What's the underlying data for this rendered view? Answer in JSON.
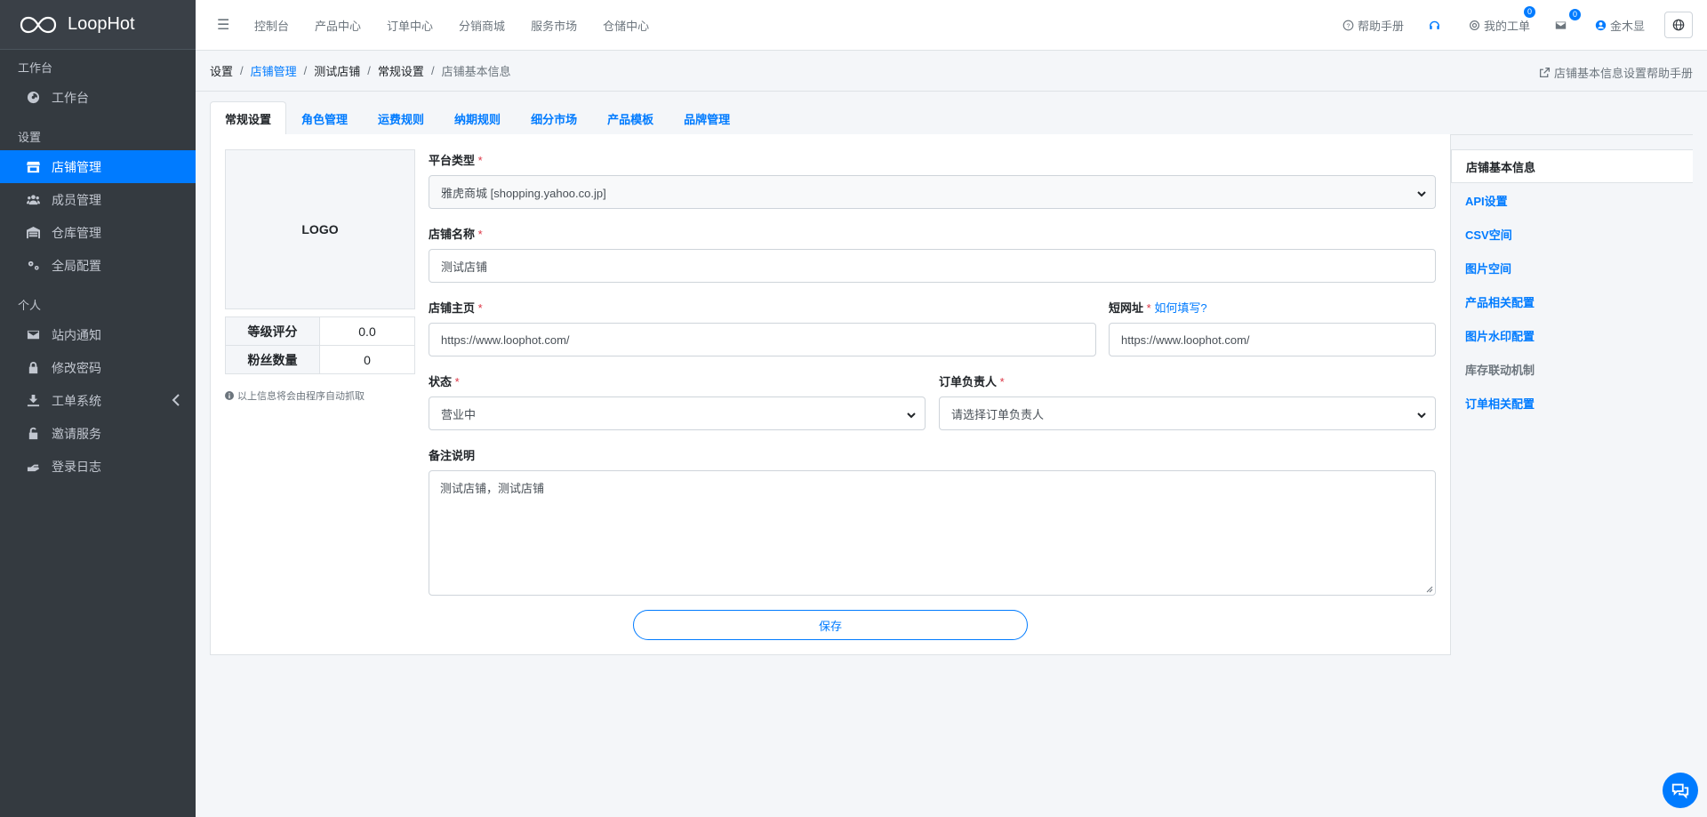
{
  "app": {
    "brand": "LoopHot"
  },
  "sidebar": {
    "sections": [
      {
        "header": "工作台",
        "items": [
          {
            "label": "工作台",
            "icon": "dashboard-icon"
          }
        ]
      },
      {
        "header": "设置",
        "items": [
          {
            "label": "店铺管理",
            "icon": "store-icon",
            "active": true
          },
          {
            "label": "成员管理",
            "icon": "users-icon"
          },
          {
            "label": "仓库管理",
            "icon": "warehouse-icon"
          },
          {
            "label": "全局配置",
            "icon": "cogs-icon"
          }
        ]
      },
      {
        "header": "个人",
        "items": [
          {
            "label": "站内通知",
            "icon": "envelope-icon"
          },
          {
            "label": "修改密码",
            "icon": "lock-icon"
          },
          {
            "label": "工单系统",
            "icon": "ticket-icon"
          },
          {
            "label": "邀请服务",
            "icon": "unlock-icon"
          },
          {
            "label": "登录日志",
            "icon": "hand-icon"
          }
        ]
      }
    ]
  },
  "topnav": {
    "items": [
      "控制台",
      "产品中心",
      "订单中心",
      "分销商城",
      "服务市场",
      "仓储中心"
    ]
  },
  "topright": {
    "help": "帮助手册",
    "tickets": "我的工单",
    "tickets_badge": "0",
    "mail_badge": "0",
    "user": "金木显"
  },
  "breadcrumb": {
    "items": [
      "设置",
      "店铺管理",
      "测试店铺",
      "常规设置",
      "店铺基本信息"
    ],
    "help_link": "店铺基本信息设置帮助手册"
  },
  "tabs": [
    "常规设置",
    "角色管理",
    "运费规则",
    "纳期规则",
    "细分市场",
    "产品模板",
    "品牌管理"
  ],
  "logo_panel": {
    "logo_text": "LOGO",
    "rating_label": "等级评分",
    "rating_value": "0.0",
    "fans_label": "粉丝数量",
    "fans_value": "0",
    "note": "以上信息将会由程序自动抓取"
  },
  "form": {
    "platform_label": "平台类型",
    "platform_value": "雅虎商城 [shopping.yahoo.co.jp]",
    "name_label": "店铺名称",
    "name_value": "测试店铺",
    "homepage_label": "店铺主页",
    "homepage_value": "https://www.loophot.com/",
    "short_label": "短网址",
    "short_hint": "如何填写?",
    "short_value": "https://www.loophot.com/",
    "status_label": "状态",
    "status_value": "营业中",
    "owner_label": "订单负责人",
    "owner_value": "请选择订单负责人",
    "remark_label": "备注说明",
    "remark_value": "测试店铺，测试店铺",
    "required_mark": "*",
    "save_label": "保存"
  },
  "side_nav": [
    "店铺基本信息",
    "API设置",
    "CSV空间",
    "图片空间",
    "产品相关配置",
    "图片水印配置",
    "库存联动机制",
    "订单相关配置"
  ]
}
